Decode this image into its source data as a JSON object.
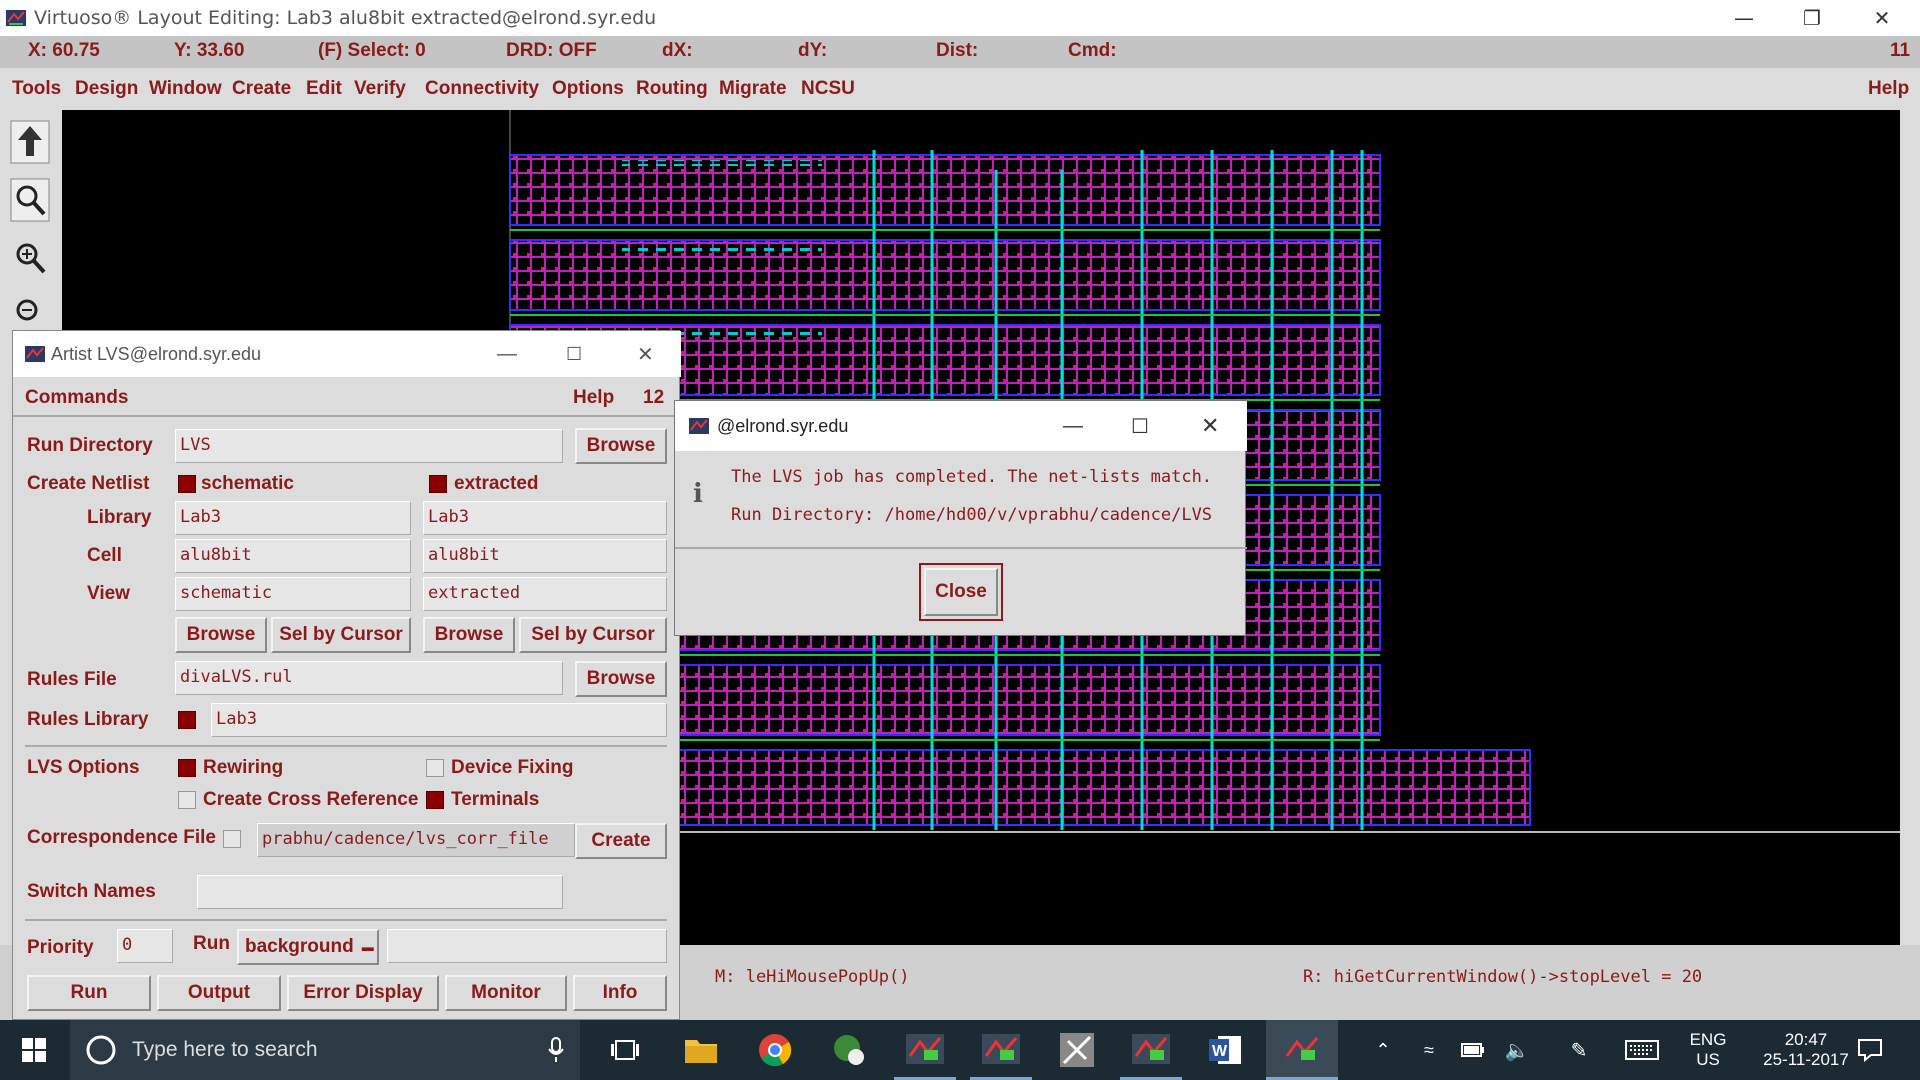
{
  "window": {
    "title": "Virtuoso® Layout Editing: Lab3 alu8bit extracted@elrond.syr.edu"
  },
  "coords": {
    "x": "X: 60.75",
    "y": "Y: 33.60",
    "select": "(F) Select: 0",
    "drd": "DRD: OFF",
    "dx": "dX:",
    "dy": "dY:",
    "dist": "Dist:",
    "cmd": "Cmd:",
    "num": "11"
  },
  "menu": {
    "items": [
      "Tools",
      "Design",
      "Window",
      "Create",
      "Edit",
      "Verify",
      "Connectivity",
      "Options",
      "Routing",
      "Migrate",
      "NCSU"
    ],
    "help": "Help"
  },
  "toolbar": {
    "icons": [
      "stop-icon",
      "zoom-fit-icon",
      "zoom-in-icon",
      "zoom-out-icon"
    ]
  },
  "status": {
    "mouse": "M: leHiMousePopUp()",
    "right": "R: hiGetCurrentWindow()->stopLevel = 20"
  },
  "lvs": {
    "title": "Artist LVS@elrond.syr.edu",
    "commands": "Commands",
    "help": "Help",
    "num": "12",
    "run_dir_label": "Run Directory",
    "run_dir": "LVS",
    "browse": "Browse",
    "create_netlist": "Create Netlist",
    "schematic": "schematic",
    "extracted": "extracted",
    "library_label": "Library",
    "cell_label": "Cell",
    "view_label": "View",
    "lib_s": "Lab3",
    "lib_e": "Lab3",
    "cell_s": "alu8bit",
    "cell_e": "alu8bit",
    "view_s": "schematic",
    "view_e": "extracted",
    "sel_by_cursor": "Sel by Cursor",
    "rules_file_label": "Rules File",
    "rules_file": "divaLVS.rul",
    "rules_lib_label": "Rules Library",
    "rules_lib": "Lab3",
    "lvs_options": "LVS Options",
    "rewiring": "Rewiring",
    "device_fixing": "Device Fixing",
    "cross_ref": "Create Cross Reference",
    "terminals": "Terminals",
    "corr_label": "Correspondence File",
    "corr_file": "prabhu/cadence/lvs_corr_file",
    "create": "Create",
    "switch_label": "Switch Names",
    "switch": "",
    "priority_label": "Priority",
    "priority": "0",
    "run_label": "Run",
    "run_mode": "background",
    "buttons": [
      "Run",
      "Output",
      "Error Display",
      "Monitor",
      "Info"
    ]
  },
  "popup": {
    "title": "@elrond.syr.edu",
    "line1": "The LVS job has completed. The net-lists match.",
    "line2": "Run Directory: /home/hd00/v/vprabhu/cadence/LVS",
    "close": "Close"
  },
  "taskbar": {
    "search_placeholder": "Type here to search",
    "lang1": "ENG",
    "lang2": "US",
    "time": "20:47",
    "date": "25-11-2017"
  }
}
